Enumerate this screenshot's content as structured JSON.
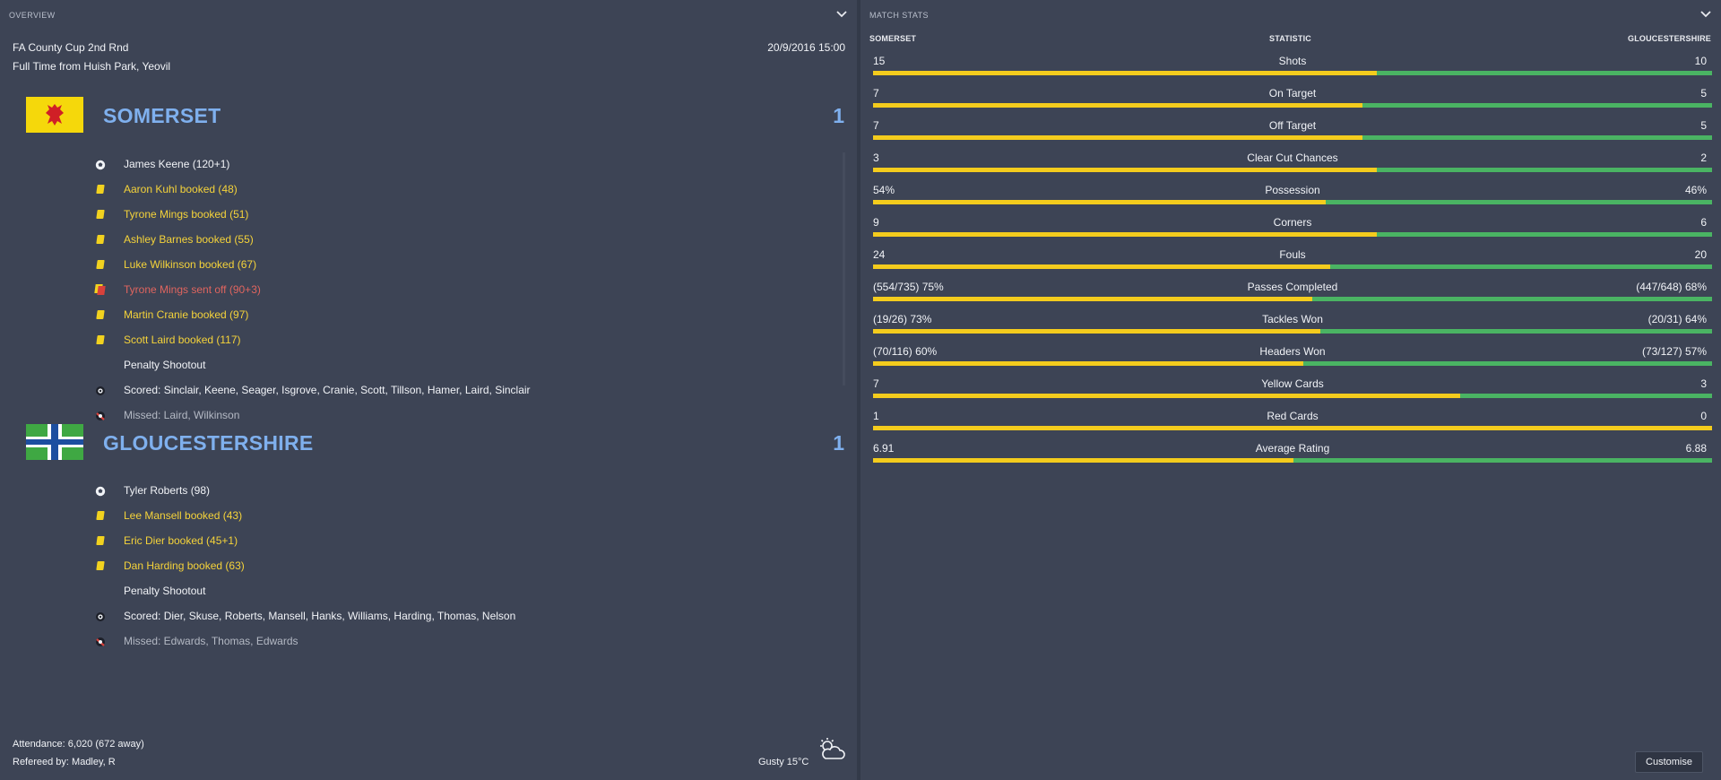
{
  "overview": {
    "title": "OVERVIEW",
    "competition": "FA County Cup 2nd Rnd",
    "venue": "Full Time from Huish Park, Yeovil",
    "datetime": "20/9/2016 15:00",
    "attendance": "Attendance: 6,020 (672 away)",
    "referee": "Refereed by: Madley, R",
    "weather": "Gusty 15°C",
    "weather_icon": "partly-cloudy-icon"
  },
  "home": {
    "name": "SOMERSET",
    "score": "1",
    "flag_colors": {
      "background": "#f5d80b",
      "emblem": "#d01f26"
    },
    "events": [
      {
        "type": "goal",
        "text": "James Keene (120+1)"
      },
      {
        "type": "yellow",
        "text": "Aaron Kuhl booked (48)"
      },
      {
        "type": "yellow",
        "text": "Tyrone Mings booked (51)"
      },
      {
        "type": "yellow",
        "text": "Ashley Barnes booked (55)"
      },
      {
        "type": "yellow",
        "text": "Luke Wilkinson booked (67)"
      },
      {
        "type": "red",
        "text": "Tyrone Mings sent off (90+3)"
      },
      {
        "type": "yellow",
        "text": "Martin Cranie booked (97)"
      },
      {
        "type": "yellow",
        "text": "Scott Laird booked (117)"
      },
      {
        "type": "heading",
        "text": "Penalty Shootout"
      },
      {
        "type": "scored",
        "text": "Scored: Sinclair, Keene, Seager, Isgrove, Cranie, Scott, Tillson, Hamer, Laird, Sinclair"
      },
      {
        "type": "missed",
        "text": "Missed: Laird, Wilkinson"
      }
    ]
  },
  "away": {
    "name": "GLOUCESTERSHIRE",
    "score": "1",
    "flag_colors": {
      "field": "#3fa843",
      "cross_white": "#ffffff",
      "cross_blue": "#1d4fa0"
    },
    "events": [
      {
        "type": "goal",
        "text": "Tyler Roberts (98)"
      },
      {
        "type": "yellow",
        "text": "Lee Mansell booked (43)"
      },
      {
        "type": "yellow",
        "text": "Eric Dier booked (45+1)"
      },
      {
        "type": "yellow",
        "text": "Dan Harding booked (63)"
      },
      {
        "type": "heading",
        "text": "Penalty Shootout"
      },
      {
        "type": "scored",
        "text": "Scored: Dier, Skuse, Roberts, Mansell, Hanks, Williams, Harding, Thomas, Nelson"
      },
      {
        "type": "missed",
        "text": "Missed: Edwards, Thomas, Edwards"
      }
    ]
  },
  "match_stats": {
    "title": "MATCH STATS",
    "col_home": "SOMERSET",
    "col_stat": "STATISTIC",
    "col_away": "GLOUCESTERSHIRE",
    "bar_colors": {
      "home": "#f4cc1d",
      "away": "#4ab463"
    },
    "rows": [
      {
        "home": "15",
        "name": "Shots",
        "away": "10",
        "home_share": 0.6
      },
      {
        "home": "7",
        "name": "On Target",
        "away": "5",
        "home_share": 0.583
      },
      {
        "home": "7",
        "name": "Off Target",
        "away": "5",
        "home_share": 0.583
      },
      {
        "home": "3",
        "name": "Clear Cut Chances",
        "away": "2",
        "home_share": 0.6
      },
      {
        "home": "54%",
        "name": "Possession",
        "away": "46%",
        "home_share": 0.54
      },
      {
        "home": "9",
        "name": "Corners",
        "away": "6",
        "home_share": 0.6
      },
      {
        "home": "24",
        "name": "Fouls",
        "away": "20",
        "home_share": 0.545
      },
      {
        "home": "(554/735) 75%",
        "name": "Passes Completed",
        "away": "(447/648) 68%",
        "home_share": 0.524
      },
      {
        "home": "(19/26) 73%",
        "name": "Tackles Won",
        "away": "(20/31) 64%",
        "home_share": 0.533
      },
      {
        "home": "(70/116) 60%",
        "name": "Headers Won",
        "away": "(73/127) 57%",
        "home_share": 0.513
      },
      {
        "home": "7",
        "name": "Yellow Cards",
        "away": "3",
        "home_share": 0.7
      },
      {
        "home": "1",
        "name": "Red Cards",
        "away": "0",
        "home_share": 1.0
      },
      {
        "home": "6.91",
        "name": "Average Rating",
        "away": "6.88",
        "home_share": 0.501
      }
    ],
    "customise_label": "Customise"
  }
}
